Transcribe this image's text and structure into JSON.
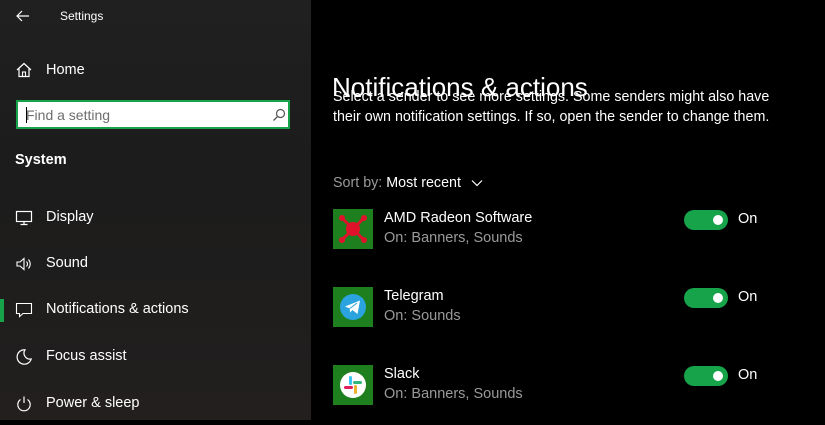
{
  "window": {
    "title": "Settings",
    "back_icon": "back-arrow-icon"
  },
  "sidebar": {
    "home": {
      "label": "Home",
      "icon": "home-icon"
    },
    "search": {
      "placeholder": "Find a setting",
      "value": "",
      "icon": "search-icon"
    },
    "section_title": "System",
    "items": [
      {
        "label": "Display",
        "icon": "display-icon",
        "selected": false
      },
      {
        "label": "Sound",
        "icon": "sound-icon",
        "selected": false
      },
      {
        "label": "Notifications & actions",
        "icon": "notifications-icon",
        "selected": true
      },
      {
        "label": "Focus assist",
        "icon": "focus-assist-icon",
        "selected": false
      },
      {
        "label": "Power & sleep",
        "icon": "power-icon",
        "selected": false
      }
    ]
  },
  "main": {
    "title": "Notifications & actions",
    "description": "Select a sender to see more settings. Some senders might also have their own notification settings. If so, open the sender to change them.",
    "sort": {
      "label": "Sort by:",
      "value": "Most recent",
      "icon": "chevron-down-icon"
    },
    "senders": [
      {
        "name": "AMD Radeon Software",
        "subtitle": "On: Banners, Sounds",
        "toggle_on": true,
        "toggle_label": "On",
        "icon": "amd-radeon-icon"
      },
      {
        "name": "Telegram",
        "subtitle": "On: Sounds",
        "toggle_on": true,
        "toggle_label": "On",
        "icon": "telegram-icon"
      },
      {
        "name": "Slack",
        "subtitle": "On: Banners, Sounds",
        "toggle_on": true,
        "toggle_label": "On",
        "icon": "slack-icon"
      }
    ]
  },
  "colors": {
    "accent": "#16a34a",
    "app_tile": "#1d7f1d",
    "sidebar_bg": "#202020",
    "main_bg": "#000000",
    "secondary_text": "#9a9a9a"
  }
}
